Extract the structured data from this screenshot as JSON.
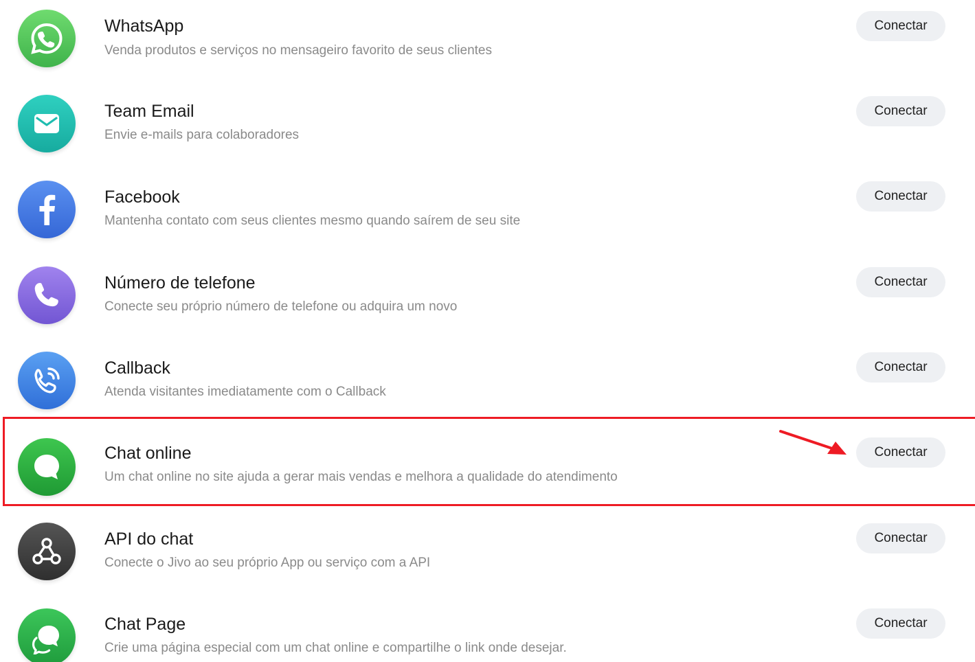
{
  "button_label": "Conectar",
  "colors": {
    "highlight": "#ee1b24",
    "arrow": "#ee1b24"
  },
  "channels": [
    {
      "id": "whatsapp",
      "title": "WhatsApp",
      "description": "Venda produtos e serviços no mensageiro favorito de seus clientes",
      "icon": "whatsapp-icon",
      "color": "#4cc354",
      "button": "Conectar"
    },
    {
      "id": "team-email",
      "title": "Team Email",
      "description": "Envie e-mails para colaboradores",
      "icon": "envelope-icon",
      "color": "#1fbdb0",
      "button": "Conectar"
    },
    {
      "id": "facebook",
      "title": "Facebook",
      "description": "Mantenha contato com seus clientes mesmo quando saírem de seu site",
      "icon": "facebook-icon",
      "color": "#3d7ae0",
      "button": "Conectar"
    },
    {
      "id": "phone-number",
      "title": "Número de telefone",
      "description": "Conecte seu próprio número de telefone ou adquira um novo",
      "icon": "phone-icon",
      "color": "#8a6ce0",
      "button": "Conectar"
    },
    {
      "id": "callback",
      "title": "Callback",
      "description": "Atenda visitantes imediatamente com o Callback",
      "icon": "callback-phone-icon",
      "color": "#3e86e6",
      "button": "Conectar"
    },
    {
      "id": "chat-online",
      "title": "Chat online",
      "description": "Um chat online no site ajuda a gerar mais vendas e melhora a qualidade do atendimento",
      "icon": "chat-bubble-icon",
      "color": "#27ad3e",
      "button": "Conectar",
      "highlighted": true
    },
    {
      "id": "chat-api",
      "title": "API do chat",
      "description": "Conecte o Jivo ao seu próprio App ou serviço com a API",
      "icon": "webhook-icon",
      "color": "#3d3d3d",
      "button": "Conectar"
    },
    {
      "id": "chat-page",
      "title": "Chat Page",
      "description": "Crie uma página especial com um chat online e compartilhe o link onde desejar.",
      "icon": "chat-page-icon",
      "color": "#2aa84a",
      "button": "Conectar"
    }
  ]
}
